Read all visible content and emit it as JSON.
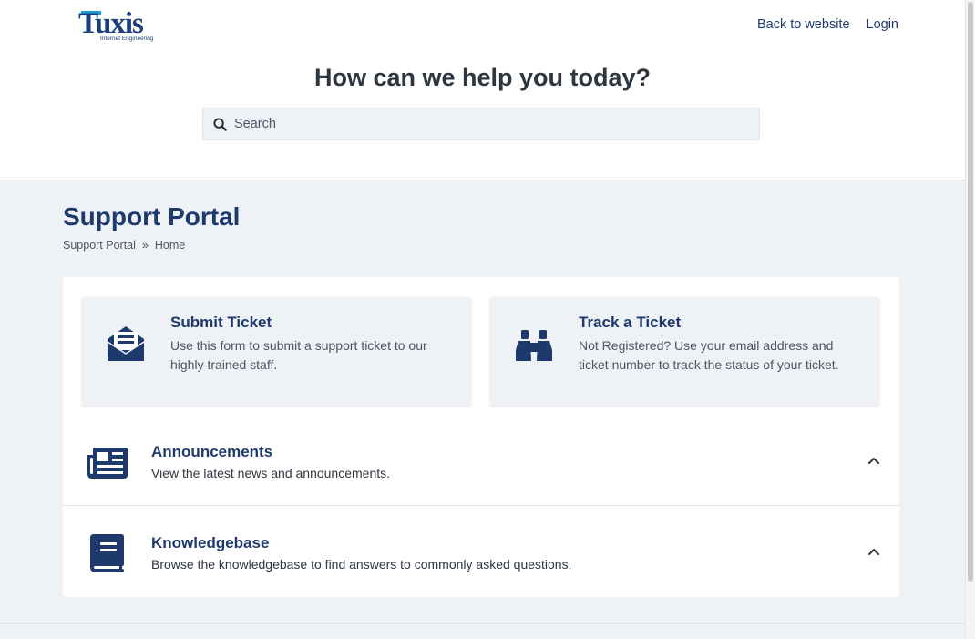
{
  "header": {
    "logo_text": "Tuxis",
    "logo_subtitle": "Internet Engineering",
    "nav": {
      "back_to_website": "Back to website",
      "login": "Login"
    }
  },
  "hero": {
    "title": "How can we help you today?",
    "search_placeholder": "Search",
    "search_value": ""
  },
  "page": {
    "title": "Support Portal",
    "breadcrumb": {
      "root": "Support Portal",
      "separator": "»",
      "current": "Home"
    }
  },
  "cards": [
    {
      "icon": "envelope-open-text-icon",
      "title": "Submit Ticket",
      "description": "Use this form to submit a support ticket to our highly trained staff."
    },
    {
      "icon": "binoculars-icon",
      "title": "Track a Ticket",
      "description": "Not Registered? Use your email address and ticket number to track the status of your ticket."
    }
  ],
  "sections": [
    {
      "icon": "newspaper-icon",
      "title": "Announcements",
      "description": "View the latest news and announcements."
    },
    {
      "icon": "book-icon",
      "title": "Knowledgebase",
      "description": "Browse the knowledgebase to find answers to commonly asked questions."
    }
  ],
  "colors": {
    "primary": "#1e3a6d",
    "background": "#eef2f6",
    "accent": "#1aa0d8"
  }
}
